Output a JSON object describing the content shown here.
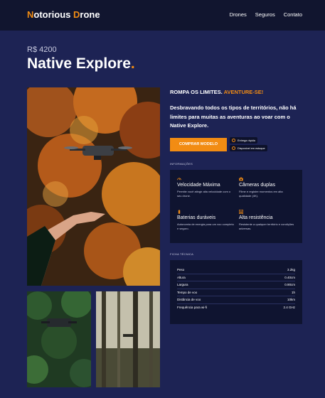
{
  "nav": {
    "logo_initial_1": "N",
    "logo_rest_1": "otorious ",
    "logo_initial_2": "D",
    "logo_rest_2": "rone",
    "links": [
      "Drones",
      "Seguros",
      "Contato"
    ]
  },
  "hero": {
    "price": "R$ 4200",
    "title": "Native Explore",
    "title_dot": "."
  },
  "product": {
    "slogan_main": "ROMPA OS LIMITES.",
    "slogan_accent": "AVENTURE-SE!",
    "description": "Desbravando todos os tipos de territórios, não há limites para muitas as aventuras ao voar com o Native Explore.",
    "cta_label": "COMPRAR MODELO",
    "badges": [
      "Entrega rápida",
      "Disponível em estoque"
    ]
  },
  "info": {
    "section_label": "INFORMAÇÕES",
    "features": [
      {
        "icon": "gauge-icon",
        "title": "Velocidade Máxima",
        "desc": "Permite você atingir alta velocidade com o seu drone."
      },
      {
        "icon": "camera-icon",
        "title": "Câmeras duplas",
        "desc": "Filme e registre momentos em alta qualidade (4K)."
      },
      {
        "icon": "battery-icon",
        "title": "Baterias duráveis",
        "desc": "Autonomia de energia para um voo completo e seguro."
      },
      {
        "icon": "shield-lines-icon",
        "title": "Alta resistência",
        "desc": "Resistente a qualquer território e condições adversas."
      }
    ]
  },
  "specs": {
    "section_label": "FICHA TÉCNICA",
    "rows": [
      {
        "label": "Peso",
        "value": "3.2kg"
      },
      {
        "label": "Altura",
        "value": "0.40cm"
      },
      {
        "label": "Largura",
        "value": "0.90cm"
      },
      {
        "label": "Tempo de voo",
        "value": "1h"
      },
      {
        "label": "Distância de voo",
        "value": "10km"
      },
      {
        "label": "Frequência para wi-fi",
        "value": "2.4 GHz"
      }
    ]
  },
  "colors": {
    "accent": "#f28c13",
    "background": "#1d2354",
    "navbar": "#11152f",
    "card": "#0f1430"
  }
}
